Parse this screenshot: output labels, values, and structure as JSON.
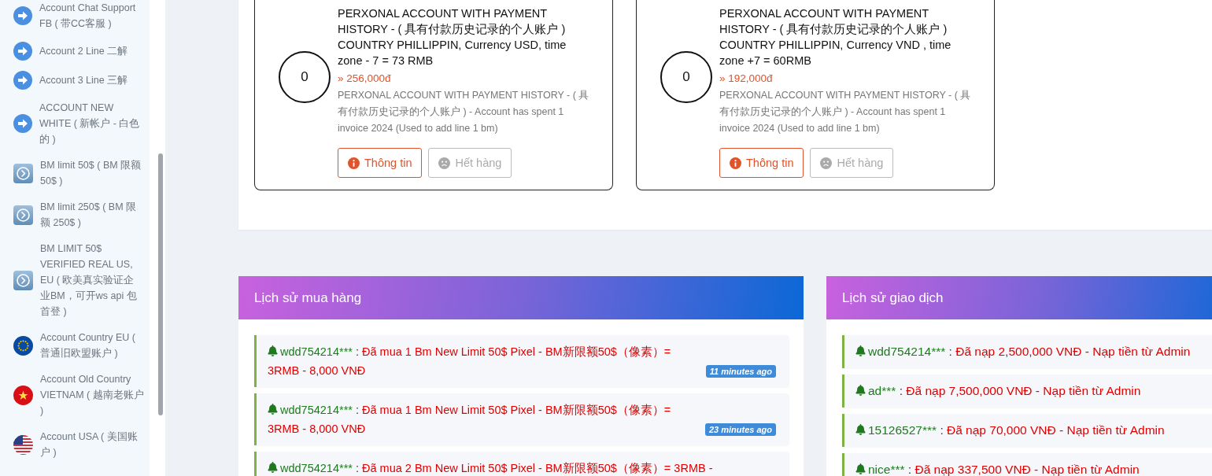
{
  "sidebar": {
    "items": [
      {
        "label": "Account Chat Support FB ( 带CC客服 )",
        "kind": "arrow"
      },
      {
        "label": "Account 2 Line 二解",
        "kind": "arrow"
      },
      {
        "label": "Account 3 Line 三解",
        "kind": "arrow"
      },
      {
        "label": "ACCOUNT NEW WHITE ( 新帐户 - 白色的 )",
        "kind": "arrow"
      },
      {
        "label": "BM limit 50$ ( BM 限额 50$ )",
        "kind": "bm"
      },
      {
        "label": "BM limit 250$ ( BM 限额 250$ )",
        "kind": "bm"
      },
      {
        "label": "BM LIMIT 50$ VERIFIED REAL US, EU ( 欧美真实验证企业BM，可开ws api 包首登 )",
        "kind": "bm"
      },
      {
        "label": "Account Country EU ( 普通旧欧盟账户 )",
        "kind": "flag_eu"
      },
      {
        "label": "Account Old Country VIETNAM ( 越南老账户 )",
        "kind": "flag_vn"
      },
      {
        "label": "Account USA ( 美国账户 )",
        "kind": "flag_us"
      }
    ]
  },
  "products": [
    {
      "counter": "0",
      "title": "PERXONAL ACCOUNT WITH PAYMENT HISTORY - ( 具有付款历史记录的个人账户 ) COUNTRY PHILLIPPIN, Currency USD, time zone - 7 = 73 RMB",
      "price": "» 256,000đ",
      "description": "PERXONAL ACCOUNT WITH PAYMENT HISTORY - ( 具有付款历史记录的个人账户 ) - Account has spent 1 invoice 2024 (Used to add line 1 bm)",
      "buttons": [
        {
          "label": "Thông tin",
          "kind": "info",
          "disabled": false
        },
        {
          "label": "Hết hàng",
          "kind": "sold_out",
          "disabled": true
        }
      ]
    },
    {
      "counter": "0",
      "title": "PERXONAL ACCOUNT WITH PAYMENT HISTORY - ( 具有付款历史记录的个人账户 ) COUNTRY PHILLIPPIN, Currency VND , time zone +7 = 60RMB",
      "price": "» 192,000đ",
      "description": "PERXONAL ACCOUNT WITH PAYMENT HISTORY - ( 具有付款历史记录的个人账户 ) - Account has spent 1 invoice 2024 (Used to add line 1 bm)",
      "buttons": [
        {
          "label": "Thông tin",
          "kind": "info",
          "disabled": false
        },
        {
          "label": "Hết hàng",
          "kind": "sold_out",
          "disabled": true
        }
      ]
    }
  ],
  "purchase_history": {
    "title": "Lịch sử mua hàng",
    "entries": [
      {
        "user": "wdd754214***",
        "separator": ":",
        "action": "Đã mua 1 Bm New Limit 50$ Pixel - BM新限额50$（像素）= 3RMB - 8,000 VNĐ",
        "time": "11 minutes ago"
      },
      {
        "user": "wdd754214***",
        "separator": ":",
        "action": "Đã mua 1 Bm New Limit 50$ Pixel - BM新限额50$（像素）= 3RMB - 8,000 VNĐ",
        "time": "23 minutes ago"
      },
      {
        "user": "wdd754214***",
        "separator": ":",
        "action": "Đã mua 2 Bm New Limit 50$ Pixel - BM新限额50$（像素）= 3RMB -"
      }
    ]
  },
  "transaction_history": {
    "title": "Lịch sử giao dịch",
    "entries": [
      {
        "user": "wdd754214***",
        "separator": ":",
        "action": "Đã nạp 2,500,000 VNĐ - Nạp tiền từ Admin"
      },
      {
        "user": "ad***",
        "separator": ":",
        "action": "Đã nạp 7,500,000 VNĐ - Nạp tiền từ Admin"
      },
      {
        "user": "15126527***",
        "separator": ":",
        "action": "Đã nạp 70,000 VNĐ - Nạp tiền từ Admin"
      },
      {
        "user": "nice***",
        "separator": ":",
        "action": "Đã nạp 337,500 VNĐ - Nạp tiền từ Admin"
      }
    ]
  }
}
